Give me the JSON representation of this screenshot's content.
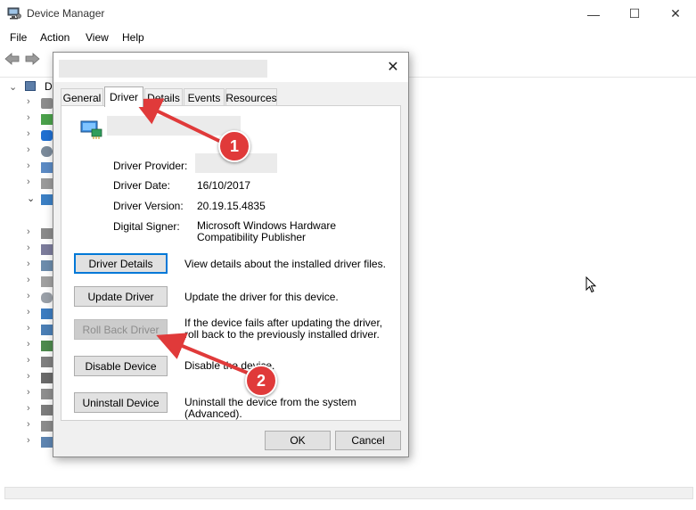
{
  "window": {
    "title": "Device Manager",
    "controls": {
      "minimize": "—",
      "maximize": "☐",
      "close": "✕"
    }
  },
  "menu": [
    "File",
    "Action",
    "View",
    "Help"
  ],
  "tree": {
    "root_visible_prefix": "D"
  },
  "dialog": {
    "tabs": [
      "General",
      "Driver",
      "Details",
      "Events",
      "Resources"
    ],
    "active_tab": "Driver",
    "close_glyph": "✕",
    "properties": [
      {
        "label": "Driver Provider:",
        "value": ""
      },
      {
        "label": "Driver Date:",
        "value": "16/10/2017"
      },
      {
        "label": "Driver Version:",
        "value": "20.19.15.4835"
      },
      {
        "label": "Digital Signer:",
        "value": "Microsoft Windows Hardware Compatibility Publisher"
      }
    ],
    "buttons": [
      {
        "label": "Driver Details",
        "description": "View details about the installed driver files.",
        "state": "focused"
      },
      {
        "label": "Update Driver",
        "description": "Update the driver for this device.",
        "state": "normal"
      },
      {
        "label": "Roll Back Driver",
        "description": "If the device fails after updating the driver, roll back to the previously installed driver.",
        "state": "disabled"
      },
      {
        "label": "Disable Device",
        "description": "Disable the device.",
        "state": "normal"
      },
      {
        "label": "Uninstall Device",
        "description": "Uninstall the device from the system (Advanced).",
        "state": "normal"
      }
    ],
    "ok_label": "OK",
    "cancel_label": "Cancel"
  },
  "annotations": [
    {
      "number": "1",
      "target": "Driver tab"
    },
    {
      "number": "2",
      "target": "Roll Back Driver button"
    }
  ],
  "colors": {
    "annotation_red": "#e03a3a",
    "focus_blue": "#0078d7",
    "dialog_bg": "#f0f0f0"
  },
  "icons": [
    "device-manager-icon",
    "back-arrow-icon",
    "forward-arrow-icon",
    "display-adapter-icon",
    "mouse-cursor-icon"
  ]
}
